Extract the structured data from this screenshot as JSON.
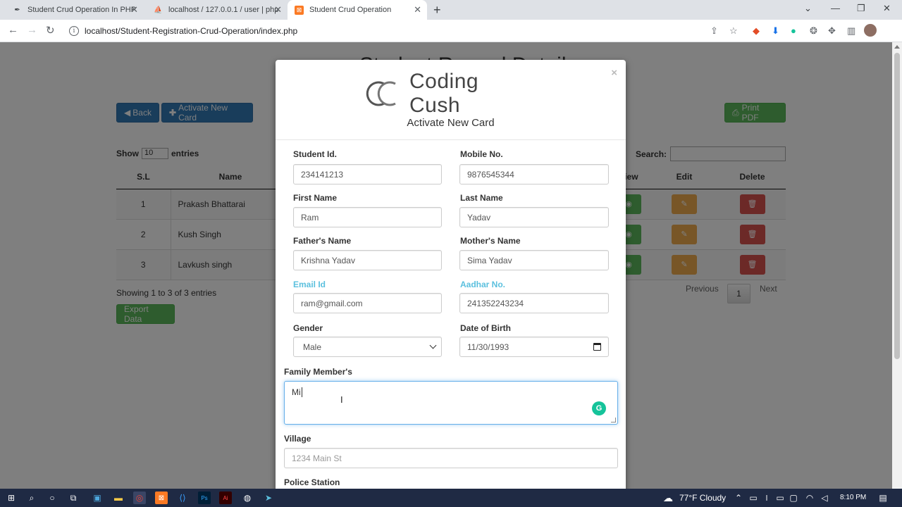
{
  "browser": {
    "tabs": [
      {
        "title": "Student Crud Operation In PHP V",
        "favicon": "feather-icon"
      },
      {
        "title": "localhost / 127.0.0.1 / user | php",
        "favicon": "phpmyadmin-icon"
      },
      {
        "title": "Student Crud Operation",
        "favicon": "xampp-icon"
      }
    ],
    "new_tab": "+",
    "url": "localhost/Student-Registration-Crud-Operation/index.php"
  },
  "page": {
    "title": "Student Record Details",
    "back_label": "Back",
    "activate_label": "Activate New Card",
    "print_label": "Print PDF",
    "show_label": "Show",
    "entries_value": "10",
    "entries_label": "entries",
    "search_label": "Search:",
    "columns": {
      "sl": "S.L",
      "name": "Name",
      "view": "View",
      "edit": "Edit",
      "delete": "Delete"
    },
    "rows": [
      {
        "sl": "1",
        "name": "Prakash Bhattarai"
      },
      {
        "sl": "2",
        "name": "Kush Singh"
      },
      {
        "sl": "3",
        "name": "Lavkush singh"
      }
    ],
    "info": "Showing 1 to 3 of 3 entries",
    "previous": "Previous",
    "current_page": "1",
    "next": "Next",
    "export_label": "Export Data"
  },
  "modal": {
    "close": "×",
    "logo_text": "Coding Cush",
    "title": "Activate New Card",
    "fields": {
      "student_id": {
        "label": "Student Id.",
        "value": "234141213"
      },
      "mobile": {
        "label": "Mobile No.",
        "value": "9876545344"
      },
      "first_name": {
        "label": "First Name",
        "value": "Ram"
      },
      "last_name": {
        "label": "Last Name",
        "value": "Yadav"
      },
      "father": {
        "label": "Father's Name",
        "value": "Krishna Yadav"
      },
      "mother": {
        "label": "Mother's Name",
        "value": "Sima Yadav"
      },
      "email": {
        "label": "Email Id",
        "value": "ram@gmail.com"
      },
      "aadhar": {
        "label": "Aadhar No.",
        "value": "241352243234"
      },
      "gender": {
        "label": "Gender",
        "value": "Male"
      },
      "dob": {
        "label": "Date of Birth",
        "value": "11/30/1993"
      },
      "family": {
        "label": "Family Member's",
        "value": "Mi"
      },
      "village": {
        "label": "Village",
        "placeholder": "1234 Main St"
      },
      "police": {
        "label": "Police Station"
      }
    }
  },
  "taskbar": {
    "weather": "77°F  Cloudy",
    "time": "8:10 PM"
  },
  "colors": {
    "primary": "#337ab7",
    "success": "#5cb85c",
    "warning": "#f0ad4e",
    "danger": "#d9534f",
    "info": "#5bc0de"
  }
}
